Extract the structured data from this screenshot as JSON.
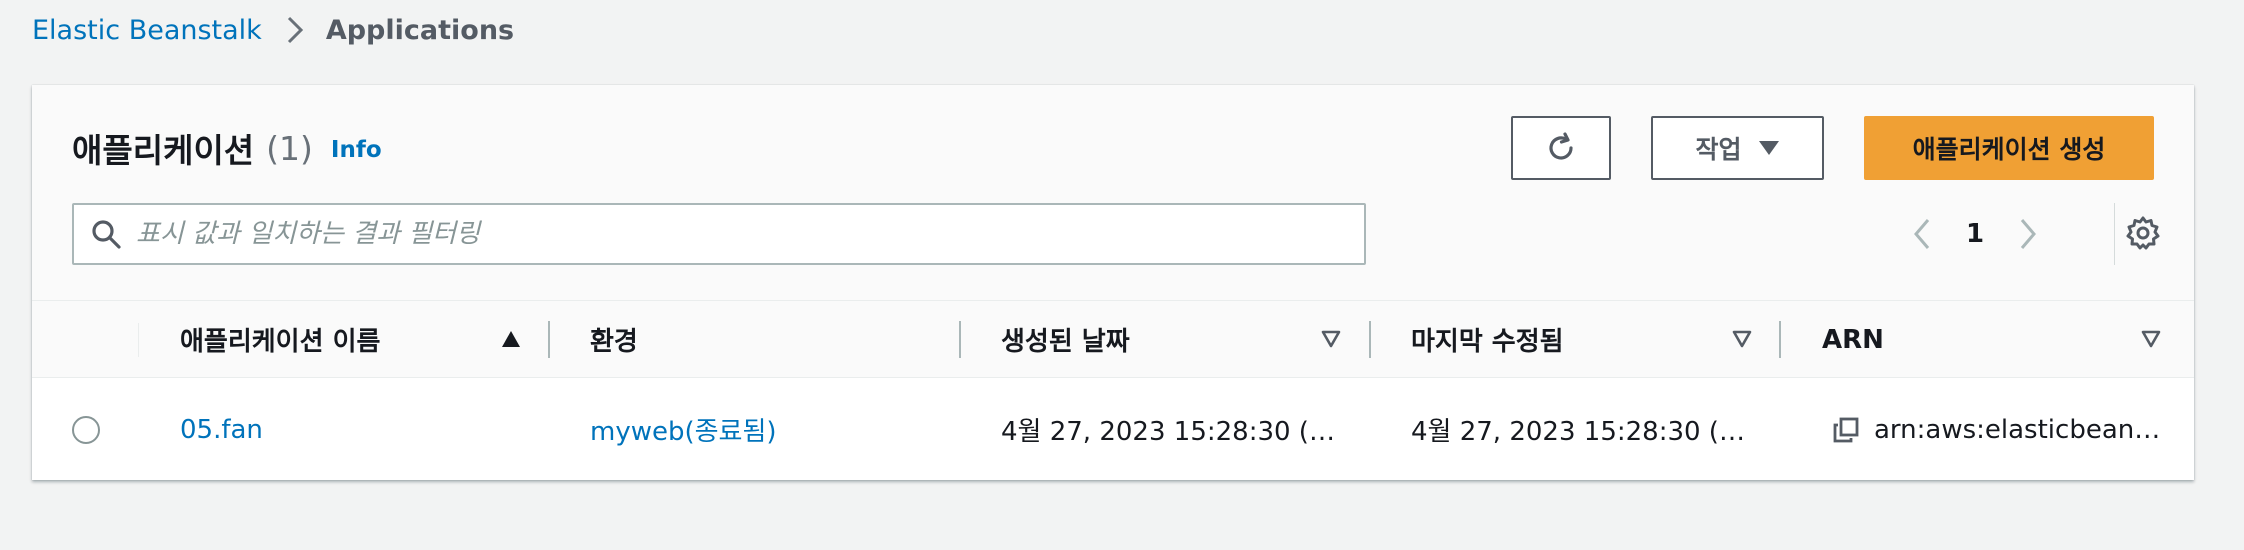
{
  "breadcrumb": {
    "items": [
      {
        "label": "Elastic Beanstalk"
      },
      {
        "label": "Applications"
      }
    ]
  },
  "panel": {
    "title": "애플리케이션",
    "count": "(1)",
    "info_link": "Info",
    "refresh_button_icon": "refresh-icon",
    "actions_button": "작업",
    "create_button": "애플리케이션 생성",
    "search": {
      "placeholder": "표시 값과 일치하는 결과 필터링",
      "value": ""
    },
    "pagination": {
      "current_page": "1"
    }
  },
  "table": {
    "columns": [
      {
        "label": "애플리케이션 이름",
        "sort": "ascending"
      },
      {
        "label": "환경",
        "sort": "none"
      },
      {
        "label": "생성된 날짜",
        "sort": "unsorted"
      },
      {
        "label": "마지막 수정됨",
        "sort": "unsorted"
      },
      {
        "label": "ARN",
        "sort": "unsorted"
      }
    ],
    "rows": [
      {
        "name": "05.fan",
        "environment": "myweb(종료됨)",
        "created": "4월 27, 2023 15:28:30 (…",
        "modified": "4월 27, 2023 15:28:30 (…",
        "arn": "arn:aws:elasticbean…"
      }
    ]
  },
  "colors": {
    "background": "#f2f3f3",
    "link": "#0073bb",
    "primary_button": "#f0a034",
    "text": "#16191f",
    "muted_text": "#545b64"
  }
}
